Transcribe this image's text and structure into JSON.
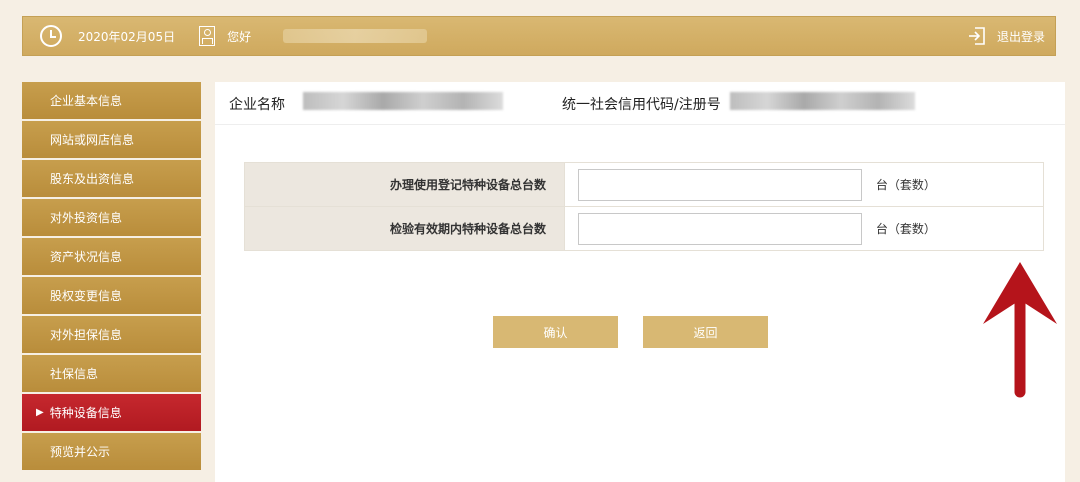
{
  "header": {
    "date": "2020年02月05日",
    "greeting": "您好",
    "logout_label": "退出登录"
  },
  "sidebar": {
    "items": [
      {
        "label": "企业基本信息",
        "active": false
      },
      {
        "label": "网站或网店信息",
        "active": false
      },
      {
        "label": "股东及出资信息",
        "active": false
      },
      {
        "label": "对外投资信息",
        "active": false
      },
      {
        "label": "资产状况信息",
        "active": false
      },
      {
        "label": "股权变更信息",
        "active": false
      },
      {
        "label": "对外担保信息",
        "active": false
      },
      {
        "label": "社保信息",
        "active": false
      },
      {
        "label": "特种设备信息",
        "active": true
      },
      {
        "label": "预览并公示",
        "active": false
      }
    ]
  },
  "company": {
    "name_label": "企业名称",
    "code_label": "统一社会信用代码/注册号"
  },
  "form": {
    "rows": [
      {
        "label": "办理使用登记特种设备总台数",
        "value": "",
        "unit": "台（套数）"
      },
      {
        "label": "检验有效期内特种设备总台数",
        "value": "",
        "unit": "台（套数）"
      }
    ]
  },
  "buttons": {
    "confirm": "确认",
    "back": "返回"
  },
  "colors": {
    "gold": "#cfa95e",
    "active_red": "#b11a21",
    "annotation_arrow": "#b5141b"
  }
}
